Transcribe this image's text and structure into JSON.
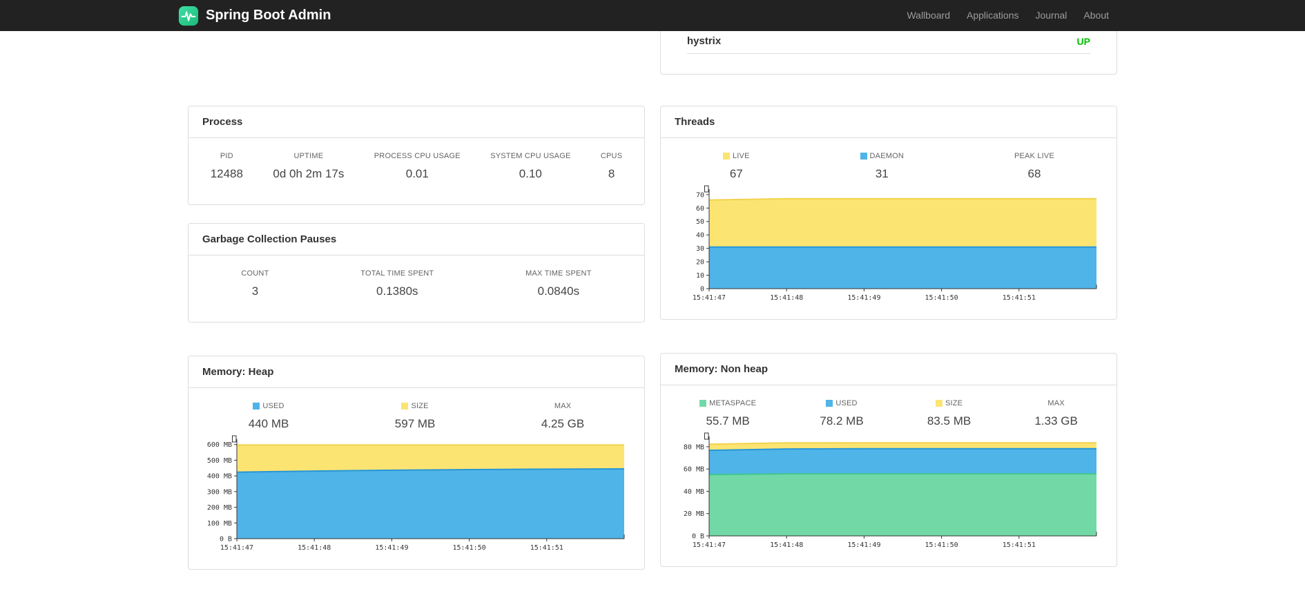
{
  "navbar": {
    "brand": "Spring Boot Admin",
    "items": [
      {
        "label": "Wallboard"
      },
      {
        "label": "Applications"
      },
      {
        "label": "Journal"
      },
      {
        "label": "About"
      }
    ]
  },
  "status_card": {
    "application": "hystrix",
    "status": "UP",
    "status_color": "#00C000"
  },
  "process": {
    "title": "Process",
    "metrics": [
      {
        "label": "PID",
        "value": "12488"
      },
      {
        "label": "UPTIME",
        "value": "0d 0h 2m 17s"
      },
      {
        "label": "PROCESS CPU USAGE",
        "value": "0.01"
      },
      {
        "label": "SYSTEM CPU USAGE",
        "value": "0.10"
      },
      {
        "label": "CPUS",
        "value": "8"
      }
    ]
  },
  "gc": {
    "title": "Garbage Collection Pauses",
    "metrics": [
      {
        "label": "COUNT",
        "value": "3"
      },
      {
        "label": "TOTAL TIME SPENT",
        "value": "0.1380s"
      },
      {
        "label": "MAX TIME SPENT",
        "value": "0.0840s"
      }
    ]
  },
  "threads": {
    "title": "Threads",
    "legend": [
      {
        "label": "LIVE",
        "value": "67",
        "color": "#FCE473"
      },
      {
        "label": "DAEMON",
        "value": "31",
        "color": "#4FB4E8"
      },
      {
        "label": "PEAK LIVE",
        "value": "68"
      }
    ]
  },
  "heap": {
    "title": "Memory: Heap",
    "legend": [
      {
        "label": "USED",
        "value": "440 MB",
        "color": "#4FB4E8"
      },
      {
        "label": "SIZE",
        "value": "597 MB",
        "color": "#FCE473"
      },
      {
        "label": "MAX",
        "value": "4.25 GB"
      }
    ]
  },
  "nonheap": {
    "title": "Memory: Non heap",
    "legend": [
      {
        "label": "METASPACE",
        "value": "55.7 MB",
        "color": "#72D9A6"
      },
      {
        "label": "USED",
        "value": "78.2 MB",
        "color": "#4FB4E8"
      },
      {
        "label": "SIZE",
        "value": "83.5 MB",
        "color": "#FCE473"
      },
      {
        "label": "MAX",
        "value": "1.33 GB"
      }
    ]
  },
  "chart_data": [
    {
      "id": "threads",
      "type": "area",
      "title": "Threads",
      "x_labels": [
        "15:41:47",
        "15:41:48",
        "15:41:49",
        "15:41:50",
        "15:41:51"
      ],
      "ylim": [
        0,
        73
      ],
      "ytick_values": [
        0,
        10,
        20,
        30,
        40,
        50,
        60,
        70
      ],
      "ytick_labels": [
        "0",
        "10",
        "20",
        "30",
        "40",
        "50",
        "60",
        "70"
      ],
      "series": [
        {
          "name": "LIVE",
          "fill": "#FCE473",
          "line": "#F2D24C",
          "values": [
            66,
            67,
            67,
            67,
            67,
            67
          ]
        },
        {
          "name": "DAEMON",
          "fill": "#4FB4E8",
          "line": "#2796D6",
          "values": [
            31,
            31,
            31,
            31,
            31,
            31
          ]
        }
      ]
    },
    {
      "id": "heap",
      "type": "area",
      "title": "Memory: Heap",
      "x_labels": [
        "15:41:47",
        "15:41:48",
        "15:41:49",
        "15:41:50",
        "15:41:51"
      ],
      "ylim": [
        0,
        625
      ],
      "ytick_values": [
        0,
        100,
        200,
        300,
        400,
        500,
        600
      ],
      "ytick_labels": [
        "0 B",
        "100 MB",
        "200 MB",
        "300 MB",
        "400 MB",
        "500 MB",
        "600 MB"
      ],
      "series": [
        {
          "name": "SIZE",
          "fill": "#FCE473",
          "line": "#F2D24C",
          "values": [
            597,
            597,
            597,
            597,
            597,
            597
          ]
        },
        {
          "name": "USED",
          "fill": "#4FB4E8",
          "line": "#2796D6",
          "values": [
            424,
            431,
            436,
            440,
            443,
            445
          ]
        }
      ]
    },
    {
      "id": "nonheap",
      "type": "area",
      "title": "Memory: Non heap",
      "x_labels": [
        "15:41:47",
        "15:41:48",
        "15:41:49",
        "15:41:50",
        "15:41:51"
      ],
      "ylim": [
        0,
        88
      ],
      "ytick_values": [
        0,
        20,
        40,
        60,
        80
      ],
      "ytick_labels": [
        "0 B",
        "20 MB",
        "40 MB",
        "60 MB",
        "80 MB"
      ],
      "series": [
        {
          "name": "SIZE",
          "fill": "#FCE473",
          "line": "#F2D24C",
          "values": [
            82.3,
            83.5,
            83.5,
            83.5,
            83.5,
            83.5
          ]
        },
        {
          "name": "USED",
          "fill": "#4FB4E8",
          "line": "#2796D6",
          "values": [
            76.8,
            78,
            78.2,
            78.2,
            78.2,
            78.2
          ]
        },
        {
          "name": "METASPACE",
          "fill": "#72D9A6",
          "line": "#41C68F",
          "values": [
            55,
            55.7,
            55.7,
            55.7,
            55.7,
            55.7
          ]
        }
      ]
    }
  ]
}
